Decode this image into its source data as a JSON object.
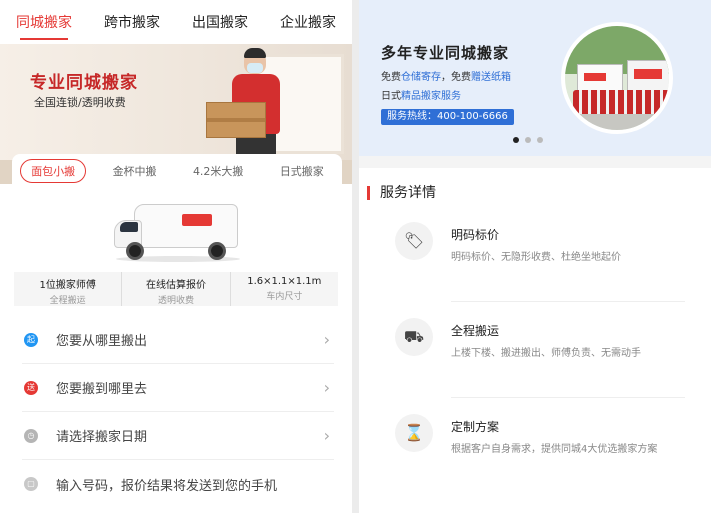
{
  "left": {
    "tabs": [
      "同城搬家",
      "跨市搬家",
      "出国搬家",
      "企业搬家"
    ],
    "active_tab": 0,
    "hero": {
      "title": "专业同城搬家",
      "subtitle": "全国连锁/透明收费"
    },
    "vehicle_tabs": [
      "面包小搬",
      "金杯中搬",
      "4.2米大搬",
      "日式搬家"
    ],
    "active_vehicle": 0,
    "specs": [
      {
        "value": "1位搬家师傅",
        "label": "全程搬运"
      },
      {
        "value": "在线估算报价",
        "label": "透明收费"
      },
      {
        "value": "1.6×1.1×1.1m",
        "label": "车内尺寸"
      }
    ],
    "rows": [
      {
        "badge": "起",
        "text": "您要从哪里搬出",
        "color": "#2196f3",
        "chevron": true
      },
      {
        "badge": "送",
        "text": "您要搬到哪里去",
        "color": "#e53935",
        "chevron": true
      },
      {
        "badge": "◷",
        "text": "请选择搬家日期",
        "color": "#b5b5b5",
        "chevron": true
      },
      {
        "badge": "▢",
        "text": "输入号码，报价结果将发送到您的手机",
        "color": "#c8c8c8",
        "chevron": false
      }
    ]
  },
  "right": {
    "banner": {
      "title": "多年专业同城搬家",
      "line1_a": "免费",
      "line1_b": "仓储寄存",
      "line1_c": "，免费",
      "line1_d": "赠送纸箱",
      "line2_a": "日式",
      "line2_b": "精品搬家服务",
      "hotline": "服务热线：400-100-6666"
    },
    "carousel": {
      "count": 3,
      "active": 0
    },
    "section_title": "服务详情",
    "services": [
      {
        "icon": "price-tag-icon",
        "glyph": "🏷",
        "title": "明码标价",
        "desc": "明码标价、无隐形收费、杜绝坐地起价"
      },
      {
        "icon": "handcart-icon",
        "glyph": "⛟",
        "title": "全程搬运",
        "desc": "上楼下楼、搬进搬出、师傅负责、无需动手"
      },
      {
        "icon": "hourglass-icon",
        "glyph": "⌛",
        "title": "定制方案",
        "desc": "根据客户自身需求，提供同城4大优选搬家方案"
      }
    ]
  }
}
